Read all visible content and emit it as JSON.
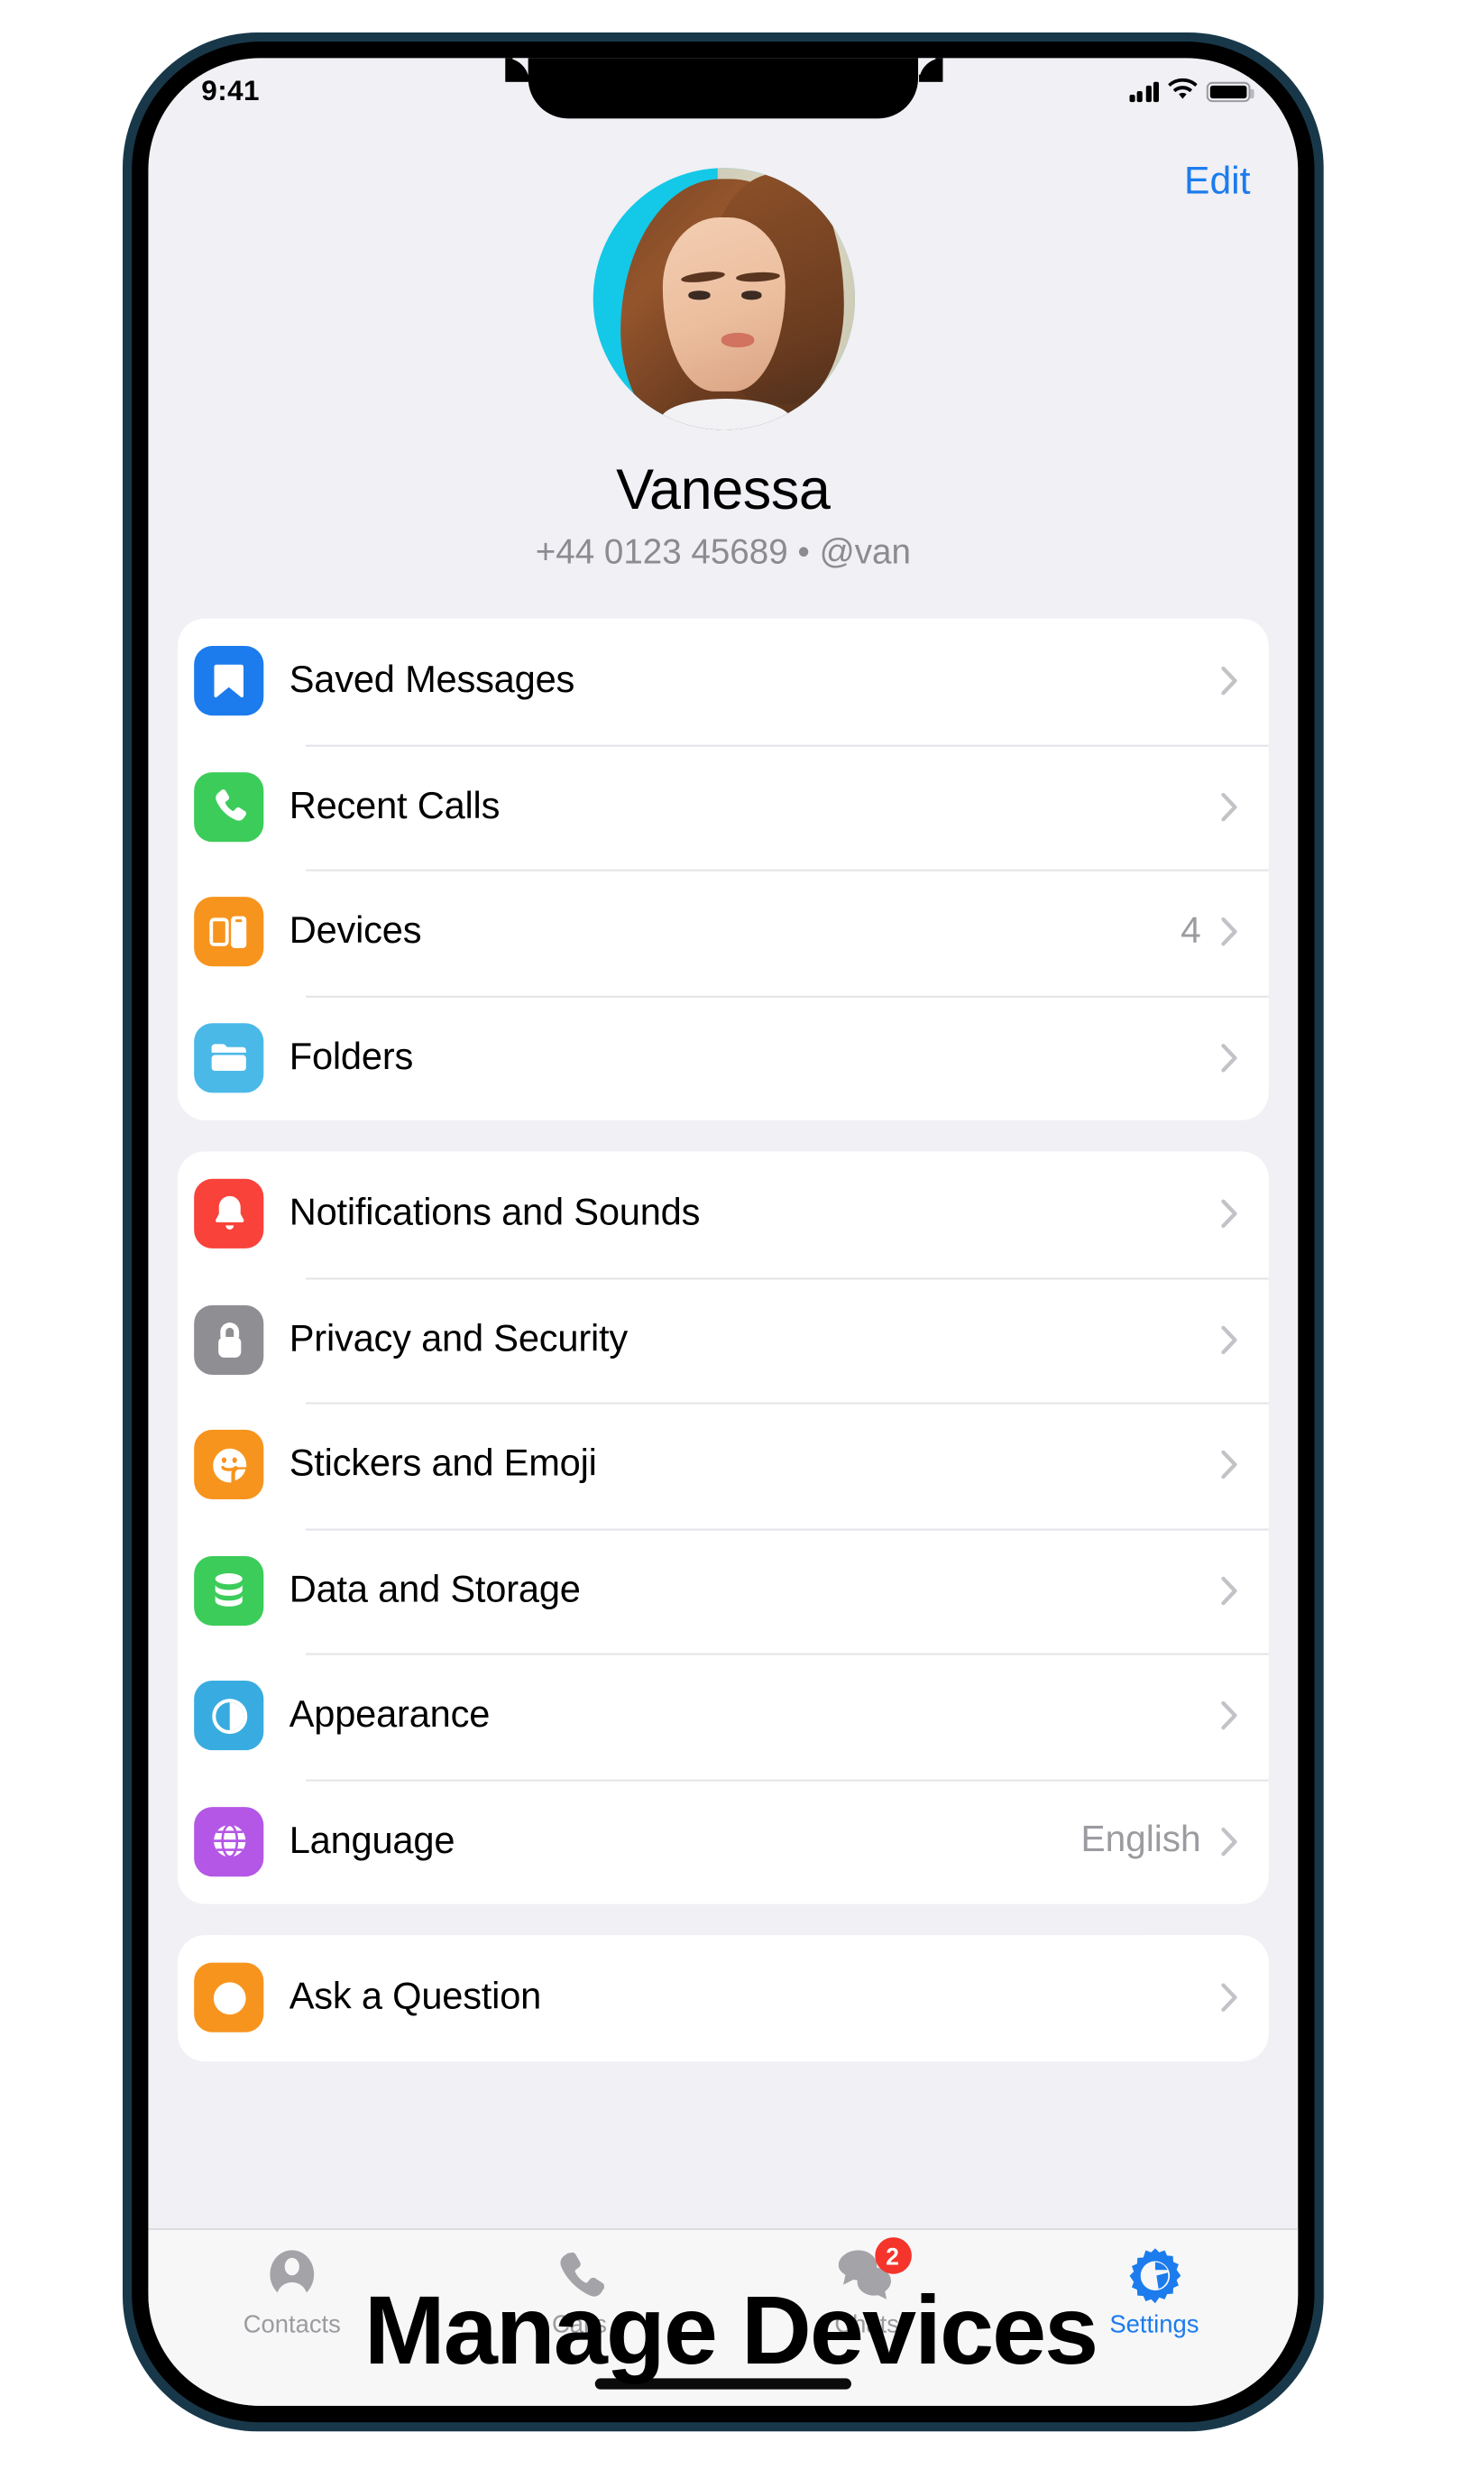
{
  "caption": "Manage Devices",
  "status_bar": {
    "time": "9:41",
    "signal_icon": "cellular-bars-icon",
    "wifi_icon": "wifi-icon",
    "battery_icon": "battery-full-icon"
  },
  "header": {
    "edit_label": "Edit",
    "avatar_name": "avatar"
  },
  "profile": {
    "name": "Vanessa",
    "subtitle": "+44 0123 45689 • @van",
    "phone": "+44 0123 45689",
    "username": "@van"
  },
  "groups": [
    {
      "id": "group-1",
      "rows": [
        {
          "label": "Saved Messages",
          "value": "",
          "icon": "bookmark-icon",
          "color": "#1c7ced"
        },
        {
          "label": "Recent Calls",
          "value": "",
          "icon": "phone-icon",
          "color": "#3ccc5a"
        },
        {
          "label": "Devices",
          "value": "4",
          "icon": "devices-icon",
          "color": "#f7941d"
        },
        {
          "label": "Folders",
          "value": "",
          "icon": "folder-icon",
          "color": "#4bb9e8"
        }
      ]
    },
    {
      "id": "group-2",
      "rows": [
        {
          "label": "Notifications and Sounds",
          "value": "",
          "icon": "bell-icon",
          "color": "#f9423a"
        },
        {
          "label": "Privacy and Security",
          "value": "",
          "icon": "lock-icon",
          "color": "#8e8e93"
        },
        {
          "label": "Stickers and Emoji",
          "value": "",
          "icon": "sticker-icon",
          "color": "#f7941d"
        },
        {
          "label": "Data and Storage",
          "value": "",
          "icon": "database-icon",
          "color": "#3ccc5a"
        },
        {
          "label": "Appearance",
          "value": "",
          "icon": "contrast-icon",
          "color": "#38ace0"
        },
        {
          "label": "Language",
          "value": "English",
          "icon": "globe-icon",
          "color": "#b457e6"
        }
      ]
    },
    {
      "id": "group-3",
      "rows": [
        {
          "label": "Ask a Question",
          "value": "",
          "icon": "question-icon",
          "color": "#f7941d"
        }
      ]
    }
  ],
  "tabs": [
    {
      "label": "Contacts",
      "icon": "person-icon",
      "badge": "",
      "active": false
    },
    {
      "label": "Calls",
      "icon": "phone-icon",
      "badge": "",
      "active": false
    },
    {
      "label": "Chats",
      "icon": "chats-icon",
      "badge": "2",
      "active": false
    },
    {
      "label": "Settings",
      "icon": "gear-icon",
      "badge": "",
      "active": true
    }
  ],
  "colors": {
    "accent": "#1c7ced",
    "badge": "#f5342b",
    "screen_bg": "#f0f0f5",
    "card_bg": "#ffffff",
    "frame": "#18384a",
    "secondary_text": "#8b8b90"
  }
}
